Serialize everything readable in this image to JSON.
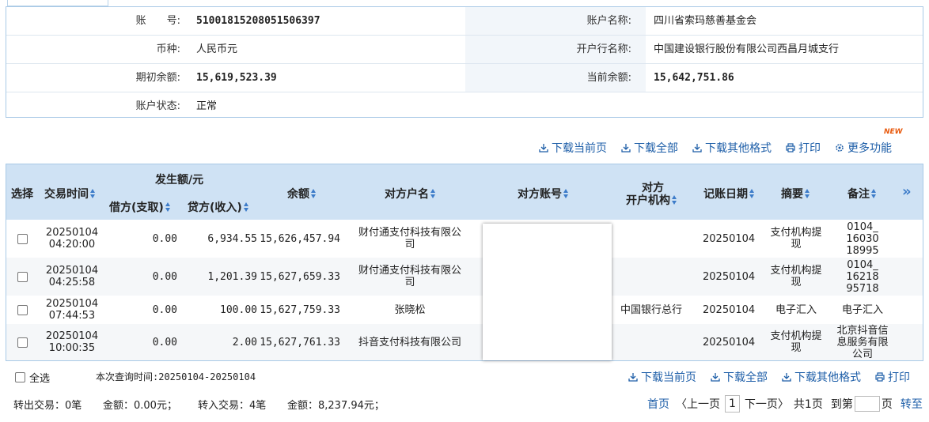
{
  "account": {
    "acct_no_label": "账　　号:",
    "acct_no": "51001815208051506397",
    "acct_name_label": "账户名称:",
    "acct_name": "四川省索玛慈善基金会",
    "currency_label": "币种:",
    "currency": "人民币元",
    "bank_label": "开户行名称:",
    "bank": "中国建设银行股份有限公司西昌月城支行",
    "opening_label": "期初余额:",
    "opening": "15,619,523.39",
    "current_label": "当前余额:",
    "current": "15,642,751.86",
    "status_label": "账户状态:",
    "status": "正常"
  },
  "top_links": {
    "download_page": "下载当前页",
    "download_all": "下载全部",
    "download_other": "下载其他格式",
    "print": "打印",
    "more": "更多功能",
    "new_badge": "NEW"
  },
  "table": {
    "headers": {
      "select": "选择",
      "time": "交易时间",
      "amount_group": "发生额/元",
      "debit": "借方(支取)",
      "credit": "贷方(收入)",
      "balance": "余额",
      "counter_name": "对方户名",
      "counter_acct": "对方账号",
      "counter_bank_1": "对方",
      "counter_bank_2": "开户机构",
      "date": "记账日期",
      "summary": "摘要",
      "note": "备注",
      "expand": "»"
    },
    "rows": [
      {
        "time1": "20250104",
        "time2": "04:20:00",
        "debit": "0.00",
        "credit": "6,934.55",
        "balance": "15,626,457.94",
        "name1": "财付通支付科技有限公",
        "name2": "司",
        "bank": "",
        "date": "20250104",
        "sum1": "支付机构提",
        "sum2": "现",
        "note1": "0104_",
        "note2": "16030",
        "note3": "18995"
      },
      {
        "time1": "20250104",
        "time2": "04:25:58",
        "debit": "0.00",
        "credit": "1,201.39",
        "balance": "15,627,659.33",
        "name1": "财付通支付科技有限公",
        "name2": "司",
        "bank": "",
        "date": "20250104",
        "sum1": "支付机构提",
        "sum2": "现",
        "note1": "0104_",
        "note2": "16218",
        "note3": "95718"
      },
      {
        "time1": "20250104",
        "time2": "07:44:53",
        "debit": "0.00",
        "credit": "100.00",
        "balance": "15,627,759.33",
        "name1": "张晓松",
        "name2": "",
        "bank": "中国银行总行",
        "date": "20250104",
        "sum1": "电子汇入",
        "sum2": "",
        "note1": "电子汇入",
        "note2": "",
        "note3": ""
      },
      {
        "time1": "20250104",
        "time2": "10:00:35",
        "debit": "0.00",
        "credit": "2.00",
        "balance": "15,627,761.33",
        "name1": "抖音支付科技有限公司",
        "name2": "",
        "bank": "",
        "date": "20250104",
        "sum1": "支付机构提",
        "sum2": "现",
        "note1": "北京抖音信",
        "note2": "息服务有限",
        "note3": "公司"
      }
    ]
  },
  "footer": {
    "select_all": "全选",
    "query_time": "本次查询时间:20250104-20250104",
    "download_page": "下载当前页",
    "download_all": "下载全部",
    "download_other": "下载其他格式",
    "print": "打印",
    "out_tx": "转出交易：0笔",
    "out_amt": "金额：0.00元；",
    "in_tx": "转入交易：4笔",
    "in_amt": "金额：8,237.94元；",
    "first": "首页",
    "prev": "〈上一页",
    "page": "1",
    "next": "下一页〉",
    "total": "共1页",
    "goto": "到第",
    "page_unit": "页",
    "go": "转至"
  }
}
